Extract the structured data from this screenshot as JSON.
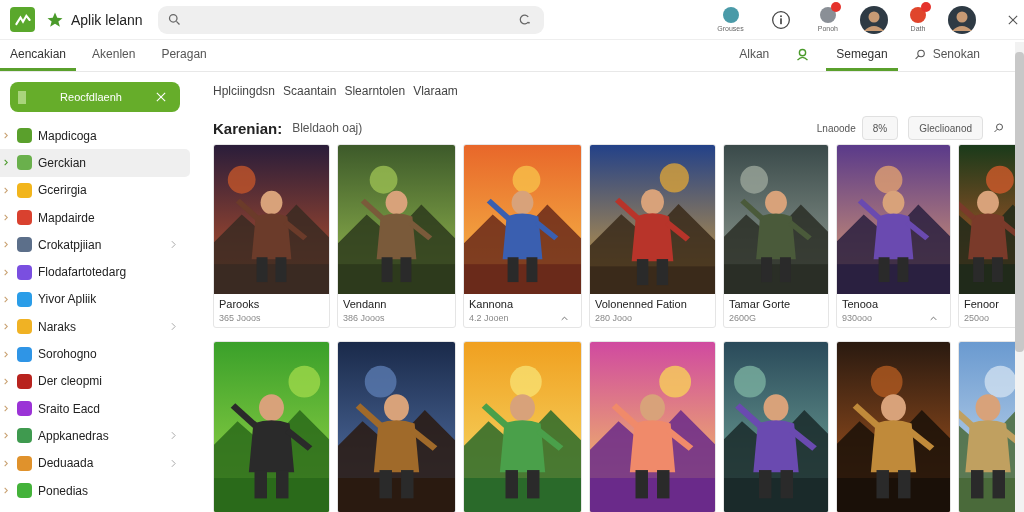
{
  "app": {
    "title": "Aplik lelann"
  },
  "top_actions": [
    {
      "kind": "labeled",
      "label": "Grouses",
      "color": "#4a9aa8",
      "badge": false
    },
    {
      "kind": "info"
    },
    {
      "kind": "labeled",
      "label": "Ponoh",
      "color": "#8a8f96",
      "badge": true
    },
    {
      "kind": "avatar"
    },
    {
      "kind": "labeled",
      "label": "Dath",
      "color": "#e0452c",
      "badge": true
    },
    {
      "kind": "avatar"
    }
  ],
  "tabs": [
    {
      "label": "Aencakian",
      "selected": true
    },
    {
      "label": "Akenlen",
      "selected": false
    },
    {
      "label": "Peragan",
      "selected": false
    }
  ],
  "right_tabs": [
    {
      "kind": "text",
      "label": "Alkan",
      "selected": false
    },
    {
      "kind": "person",
      "selected": false
    },
    {
      "kind": "text",
      "label": "Semegan",
      "selected": true
    },
    {
      "kind": "search",
      "label": "Senokan",
      "selected": false
    }
  ],
  "sidebar": {
    "button": "Reocfdlaenh",
    "items": [
      {
        "label": "Mapdicoga",
        "color": "#5aa02c",
        "selected": false,
        "expandable": false
      },
      {
        "label": "Gerckian",
        "color": "#6ab04c",
        "selected": true,
        "expandable": false
      },
      {
        "label": "Gcerirgia",
        "color": "#f2b51c",
        "selected": false,
        "expandable": false
      },
      {
        "label": "Mapdairde",
        "color": "#d9412f",
        "selected": false,
        "expandable": false
      },
      {
        "label": "Crokatpjiian",
        "color": "#5c6f8a",
        "selected": false,
        "expandable": true
      },
      {
        "label": "Flodafartotedarg",
        "color": "#7a4fe0",
        "selected": false,
        "expandable": false
      },
      {
        "label": "Yivor Apliik",
        "color": "#2a9de8",
        "selected": false,
        "expandable": false
      },
      {
        "label": "Naraks",
        "color": "#f0b224",
        "selected": false,
        "expandable": true
      },
      {
        "label": "Sorohogno",
        "color": "#2f95e6",
        "selected": false,
        "expandable": false
      },
      {
        "label": "Der cleopmi",
        "color": "#b8231e",
        "selected": false,
        "expandable": false
      },
      {
        "label": "Sraito Eacd",
        "color": "#9b33d6",
        "selected": false,
        "expandable": false
      },
      {
        "label": "Appkanedras",
        "color": "#3f9a4f",
        "selected": false,
        "expandable": true
      },
      {
        "label": "Deduaada",
        "color": "#e0922c",
        "selected": false,
        "expandable": true
      },
      {
        "label": "Ponedias",
        "color": "#44b23a",
        "selected": false,
        "expandable": false
      }
    ]
  },
  "subtabs": [
    "Hplciingdsn",
    "Scaantain",
    "Slearntolen",
    "Vlaraam"
  ],
  "section": {
    "title": "Karenian:",
    "subtitle": "Bleldaoh oaj)",
    "sort_label": "Lnaoode",
    "buttons": [
      "8%",
      "Gleclioanod"
    ]
  },
  "cards": [
    {
      "kind": "picture",
      "title": "Parooks",
      "subtitle": "365 Jooos",
      "caret": false
    },
    {
      "kind": "picture",
      "title": "Vendann",
      "subtitle": "386 Jooos",
      "caret": false
    },
    {
      "kind": "picture",
      "title": "Kannona",
      "subtitle": "4.2 Jooen",
      "caret": true
    },
    {
      "kind": "picture",
      "title": "Volonenned Fation",
      "subtitle": "280 Jooo",
      "caret": false
    },
    {
      "kind": "picture",
      "title": "Tamar Gorte",
      "subtitle": "2600G",
      "caret": false
    },
    {
      "kind": "picture",
      "title": "Tenooa",
      "subtitle": "930ooo",
      "caret": true
    },
    {
      "kind": "picture",
      "title": "Fenoor",
      "subtitle": "250oo",
      "caret": false
    }
  ]
}
